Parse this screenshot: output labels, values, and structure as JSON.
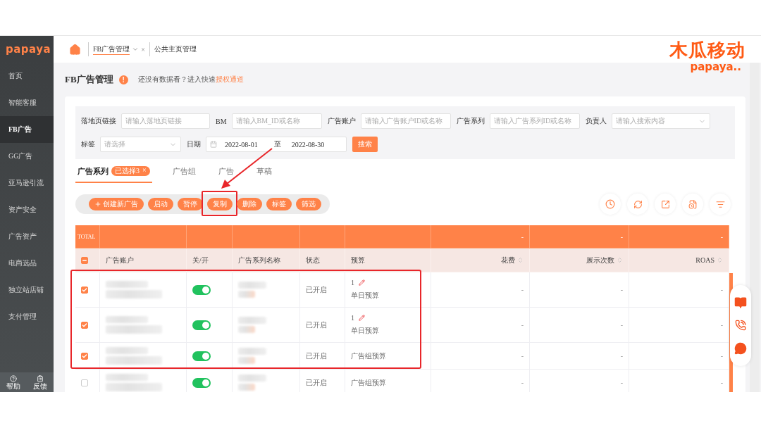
{
  "sidebar": {
    "logo": "papaya",
    "items": [
      {
        "label": "首页",
        "selected": false
      },
      {
        "label": "智能客服",
        "selected": false
      },
      {
        "label": "FB广告",
        "selected": true
      },
      {
        "label": "GG广告",
        "selected": false
      },
      {
        "label": "亚马逊引流",
        "selected": false
      },
      {
        "label": "资产安全",
        "selected": false
      },
      {
        "label": "广告资产",
        "selected": false
      },
      {
        "label": "电商选品",
        "selected": false
      },
      {
        "label": "独立站店铺",
        "selected": false
      },
      {
        "label": "支付管理",
        "selected": false
      }
    ],
    "footer": [
      {
        "label": "帮助",
        "kind": "help"
      },
      {
        "label": "反馈",
        "kind": "feedback"
      }
    ]
  },
  "top_tabs": [
    {
      "label": "FB广告管理",
      "selected": true,
      "close": "×"
    },
    {
      "label": "公共主页管理",
      "selected": false
    }
  ],
  "brand_overlay": {
    "title": "木瓜移动",
    "subtitle": "papaya.."
  },
  "page": {
    "title": "FB广告管理",
    "title_badge": "!",
    "notice": "还没有数据看？进入快速",
    "notice_link": "授权通道"
  },
  "filters": [
    {
      "kind": "input",
      "label": "落地页链接",
      "placeholder": "请输入落地页链接"
    },
    {
      "kind": "input",
      "label": "BM",
      "placeholder": "请输入BM_ID或名称"
    },
    {
      "kind": "input",
      "label": "广告账户",
      "placeholder": "请输入广告账户ID或名称"
    },
    {
      "kind": "input",
      "label": "广告系列",
      "placeholder": "请输入广告系列ID或名称"
    },
    {
      "kind": "select",
      "label": "负责人",
      "placeholder": "请输入搜索内容"
    },
    {
      "kind": "select",
      "label": "标签",
      "placeholder": "请选择"
    },
    {
      "kind": "daterange",
      "label": "日期",
      "start": "2022-08-01",
      "separator": "至",
      "end": "2022-08-30"
    }
  ],
  "search_button": "搜索",
  "level_tabs": [
    {
      "label": "广告系列",
      "selected": true,
      "badge": "已选择3",
      "badge_close": "×"
    },
    {
      "label": "广告组",
      "selected": false
    },
    {
      "label": "广告",
      "selected": false
    },
    {
      "label": "草稿",
      "selected": false
    }
  ],
  "actions": [
    {
      "label": "创建新广告",
      "kind": "create",
      "highlighted": false
    },
    {
      "label": "启动",
      "kind": "plain",
      "highlighted": false
    },
    {
      "label": "暂停",
      "kind": "plain",
      "highlighted": false
    },
    {
      "label": "复制",
      "kind": "plain",
      "highlighted": true
    },
    {
      "label": "删除",
      "kind": "plain",
      "highlighted": false
    },
    {
      "label": "标签",
      "kind": "plain",
      "highlighted": false
    },
    {
      "label": "筛选",
      "kind": "plain",
      "highlighted": false
    }
  ],
  "annotation_arrow": true,
  "table": {
    "total_label": "TOTAL",
    "total_values": [
      "-",
      "-",
      "-"
    ],
    "select_all_partial": true,
    "columns": [
      {
        "label": "广告账户",
        "sortable": false
      },
      {
        "label": "关/开",
        "sortable": false
      },
      {
        "label": "广告系列名称",
        "sortable": false
      },
      {
        "label": "状态",
        "sortable": false
      },
      {
        "label": "预算",
        "sortable": false
      },
      {
        "label": "花费",
        "sortable": true
      },
      {
        "label": "展示次数",
        "sortable": true
      },
      {
        "label": "ROAS",
        "sortable": true
      }
    ],
    "rows": [
      {
        "checked": true,
        "highlighted": true,
        "blurred": true,
        "on": true,
        "status": "已开启",
        "budget": "1",
        "budget_editable": true,
        "budget_type": "单日预算",
        "metrics": [
          "-",
          "-",
          "-"
        ]
      },
      {
        "checked": true,
        "highlighted": true,
        "blurred": true,
        "on": true,
        "status": "已开启",
        "budget": "1",
        "budget_editable": true,
        "budget_type": "单日预算",
        "metrics": [
          "-",
          "-",
          "-"
        ]
      },
      {
        "checked": true,
        "highlighted": true,
        "blurred": true,
        "on": true,
        "status": "已开启",
        "budget_type": "广告组预算",
        "metrics": [
          "-",
          "-",
          "-"
        ]
      },
      {
        "checked": false,
        "highlighted": false,
        "blurred": true,
        "on": true,
        "status": "已开启",
        "budget_type": "广告组预算",
        "metrics": [
          "-",
          "-",
          "-"
        ]
      }
    ]
  }
}
